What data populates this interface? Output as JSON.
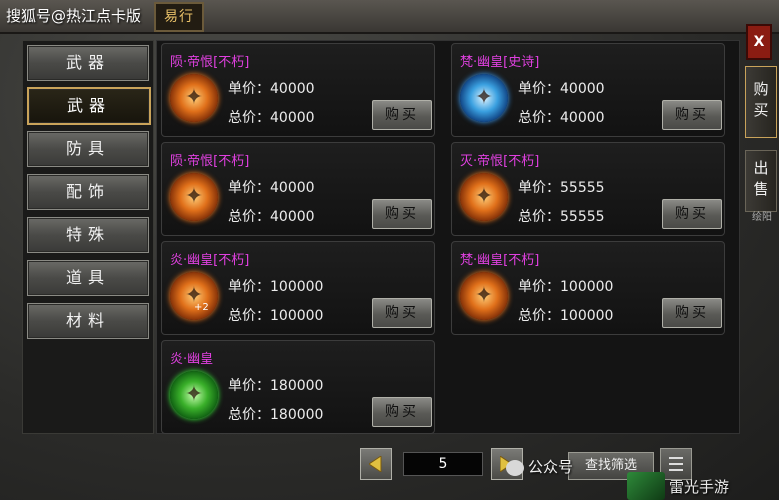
{
  "watermark_top": "搜狐号@热江点卡版",
  "title_badge": "易行",
  "close_label": "X",
  "side_tabs": {
    "buy": "购买",
    "sell": "出售",
    "sell_sub": "绘阳"
  },
  "categories": [
    {
      "label": "武器",
      "active": false
    },
    {
      "label": "武器",
      "active": true
    },
    {
      "label": "防具",
      "active": false
    },
    {
      "label": "配饰",
      "active": false
    },
    {
      "label": "特殊",
      "active": false
    },
    {
      "label": "道具",
      "active": false
    },
    {
      "label": "材料",
      "active": false
    }
  ],
  "items": [
    {
      "name": "陨·帝恨[不朽]",
      "icon": "fire",
      "unit": "单价：40000",
      "total": "总价：40000",
      "buy": "购买"
    },
    {
      "name": "梵·幽皇[史诗]",
      "icon": "ice",
      "unit": "单价：40000",
      "total": "总价：40000",
      "buy": "购买"
    },
    {
      "name": "陨·帝恨[不朽]",
      "icon": "fire",
      "unit": "单价：40000",
      "total": "总价：40000",
      "buy": "购买"
    },
    {
      "name": "灭·帝恨[不朽]",
      "icon": "fire",
      "unit": "单价：55555",
      "total": "总价：55555",
      "buy": "购买"
    },
    {
      "name": "炎·幽皇[不朽]",
      "icon": "fire",
      "unit": "单价：100000",
      "total": "总价：100000",
      "buy": "购买",
      "plus": "+2"
    },
    {
      "name": "梵·幽皇[不朽]",
      "icon": "fire",
      "unit": "单价：100000",
      "total": "总价：100000",
      "buy": "购买"
    },
    {
      "name": "炎·幽皇",
      "icon": "green",
      "unit": "单价：180000",
      "total": "总价：180000",
      "buy": "购买"
    }
  ],
  "pagination": {
    "page": "5"
  },
  "filter_label": "查找筛选",
  "wechat_text": "公众号",
  "watermark_corner": "雷光手游"
}
